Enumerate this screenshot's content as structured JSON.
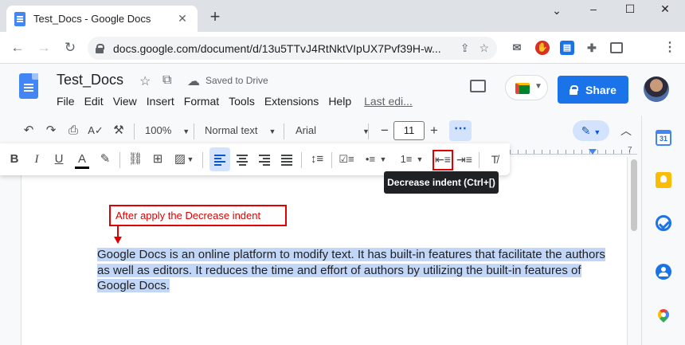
{
  "browser": {
    "tab_title": "Test_Docs - Google Docs",
    "tab_close": "✕",
    "new_tab": "+",
    "url": "docs.google.com/document/d/13u5TTvJ4RtNktVIpUX7Pvf39H-w...",
    "window_controls": {
      "minimize": "–",
      "maximize": "☐",
      "close": "✕"
    },
    "nav": {
      "back": "←",
      "forward": "→",
      "reload": "↻"
    }
  },
  "docs": {
    "title": "Test_Docs",
    "saved_status": "Saved to Drive",
    "menu": [
      "File",
      "Edit",
      "View",
      "Insert",
      "Format",
      "Tools",
      "Extensions",
      "Help"
    ],
    "last_edit": "Last edi...",
    "share_label": "Share"
  },
  "toolbar": {
    "zoom": "100%",
    "style": "Normal text",
    "font": "Arial",
    "font_size": "11",
    "minus": "−",
    "plus": "+",
    "more": "⋯",
    "ruler_number": "7"
  },
  "tooltip": "Decrease indent (Ctrl+[)",
  "annotation": "After apply the Decrease indent",
  "body_text": "Google Docs is an online platform to modify text. It has built-in features that facilitate the authors as well as editors. It reduces the time and effort of authors by utilizing the built-in features of Google Docs.",
  "side_panel": {
    "calendar_day": "31"
  },
  "colors": {
    "accent": "#1a73e8",
    "selection": "#c2d7f7",
    "annotation_red": "#e00000"
  }
}
